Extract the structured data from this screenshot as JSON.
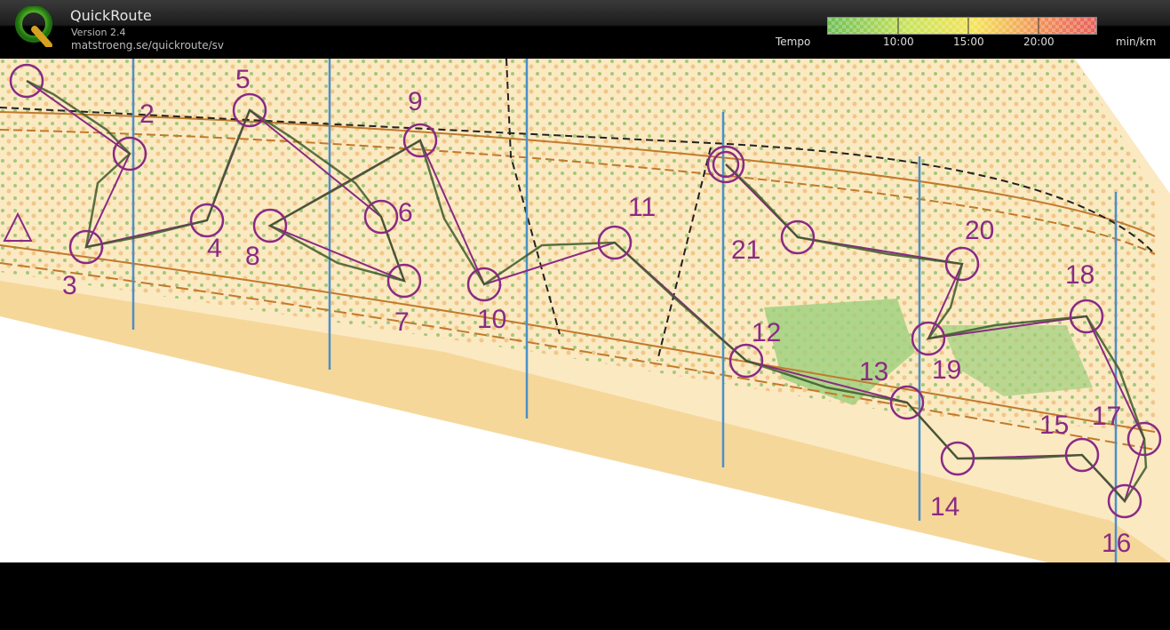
{
  "app": {
    "title": "QuickRoute",
    "version": "Version 2.4",
    "url": "matstroeng.se/quickroute/sv",
    "logo_icon": "quickroute-q-logo"
  },
  "legend": {
    "label": "Tempo",
    "ticks": [
      "10:00",
      "15:00",
      "20:00"
    ],
    "unit": "min/km",
    "colors": [
      "#6fbf58",
      "#c9e35a",
      "#f5e35a",
      "#f0905a",
      "#e8605a"
    ]
  },
  "map": {
    "course_color": "#8a2a84",
    "route_color": "#3c5a2a",
    "controls": [
      "2",
      "3",
      "4",
      "5",
      "6",
      "7",
      "8",
      "9",
      "10",
      "11",
      "12",
      "13",
      "14",
      "15",
      "16",
      "17",
      "18",
      "19",
      "20",
      "21"
    ]
  }
}
